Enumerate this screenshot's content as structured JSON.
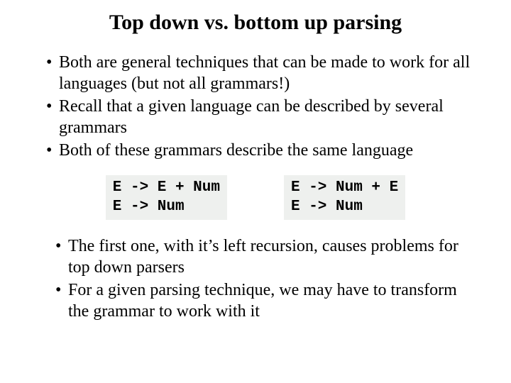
{
  "title": "Top down vs. bottom up parsing",
  "top_bullets": [
    "Both are general techniques that can be made to work for all languages (but not all grammars!)",
    "Recall that a given language can be described by several grammars",
    "Both of these grammars describe the same language"
  ],
  "grammars": {
    "left": "E -> E + Num\nE -> Num",
    "right": "E -> Num + E\nE -> Num"
  },
  "bottom_bullets": [
    "The first one, with it’s left recursion, causes problems for top down parsers",
    "For a given parsing technique, we may have to transform the grammar to work with it"
  ]
}
